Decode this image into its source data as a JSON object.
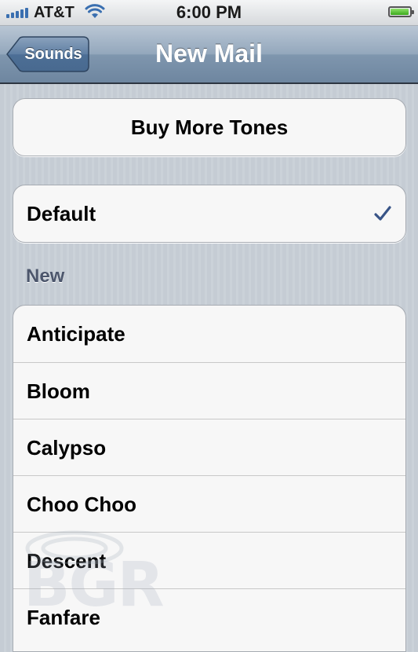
{
  "status_bar": {
    "carrier": "AT&T",
    "time": "6:00 PM",
    "signal_icon": "signal-bars-icon",
    "wifi_icon": "wifi-icon",
    "battery_icon": "battery-icon",
    "battery_level": 0.95
  },
  "nav": {
    "title": "New Mail",
    "back_label": "Sounds"
  },
  "buy_group": {
    "label": "Buy More Tones"
  },
  "default_group": {
    "label": "Default",
    "selected": true,
    "check_icon": "checkmark-icon"
  },
  "section": {
    "header": "New",
    "items": [
      {
        "label": "Anticipate"
      },
      {
        "label": "Bloom"
      },
      {
        "label": "Calypso"
      },
      {
        "label": "Choo Choo"
      },
      {
        "label": "Descent"
      },
      {
        "label": "Fanfare"
      }
    ]
  },
  "watermark": {
    "text": "BGR"
  },
  "colors": {
    "nav_bar": "#7f96ae",
    "checkmark": "#385487",
    "section_header": "#4c566c",
    "background": "#c5ccd4"
  }
}
